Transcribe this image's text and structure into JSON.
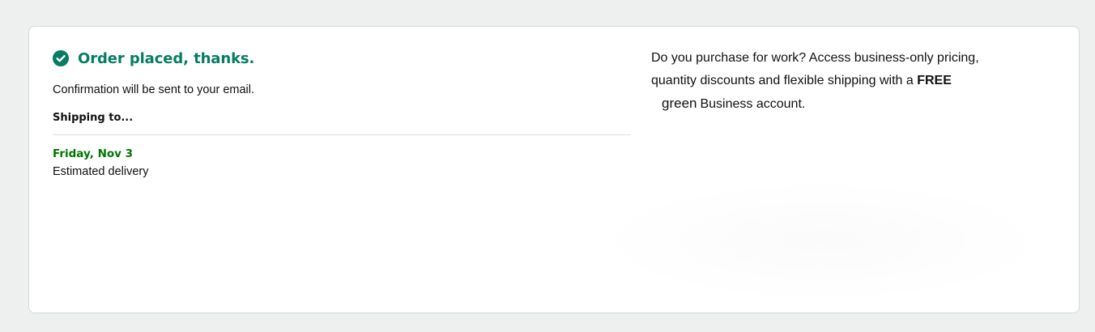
{
  "order": {
    "title": "Order placed, thanks.",
    "confirmation": "Confirmation will be sent to your email.",
    "shipping_heading": "Shipping to...",
    "delivery_date": "Friday, Nov 3",
    "delivery_label": "Estimated delivery"
  },
  "promo": {
    "line1": "Do you purchase for work? Access business-only pricing,",
    "line2_prefix": "quantity discounts and flexible shipping with a ",
    "line2_bold": "FREE",
    "line3_green": "green",
    "line3_rest": "Business account."
  },
  "colors": {
    "success_green": "#067d62",
    "delivery_green": "#007600",
    "text": "#0f1111",
    "page_bg": "#eef0f0",
    "card_border": "#d5d9d9"
  },
  "icons": {
    "success": "check-circle-icon"
  }
}
